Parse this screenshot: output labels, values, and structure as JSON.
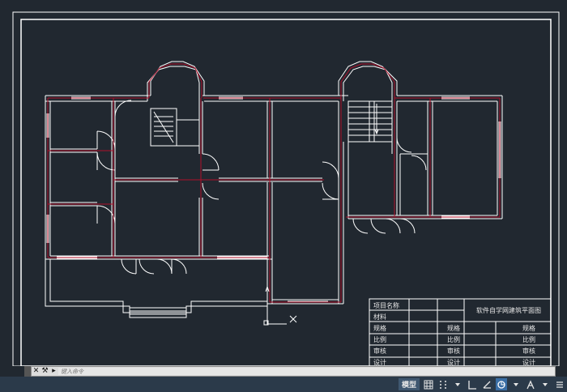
{
  "title_block": {
    "row1_label": "项目名称",
    "drawing_title": "软件自学网建筑平面图",
    "row2_label": "材料",
    "spec_label": "规格",
    "spec_label_2": "规格",
    "spec_label_3": "规格",
    "scale_label": "比例",
    "scale_label_2": "比例",
    "scale_label_3": "比例",
    "review_label": "审核",
    "review_label_2": "审核",
    "review_label_3": "审核",
    "design_label": "设计",
    "design_label_2": "设计",
    "design_label_3": "设计"
  },
  "command_line": {
    "close_glyph": "✕",
    "wrench_glyph": "⚒",
    "recent_glyph": "▸",
    "placeholder": "键入命令"
  },
  "status_bar": {
    "model_label": "模型",
    "grid_icon": "grid-icon",
    "snap_icon": "snap-icon",
    "ortho_icon": "ortho-icon",
    "polar_icon": "polar-icon",
    "osnap_icon": "osnap-icon",
    "annotate_icon": "annotate-icon",
    "colors": {
      "background": "#212830",
      "wall_red": "#b0102a",
      "line_white": "#ffffff",
      "statusbar": "#2b3a4a",
      "active_blue": "#3a6ea5"
    }
  }
}
